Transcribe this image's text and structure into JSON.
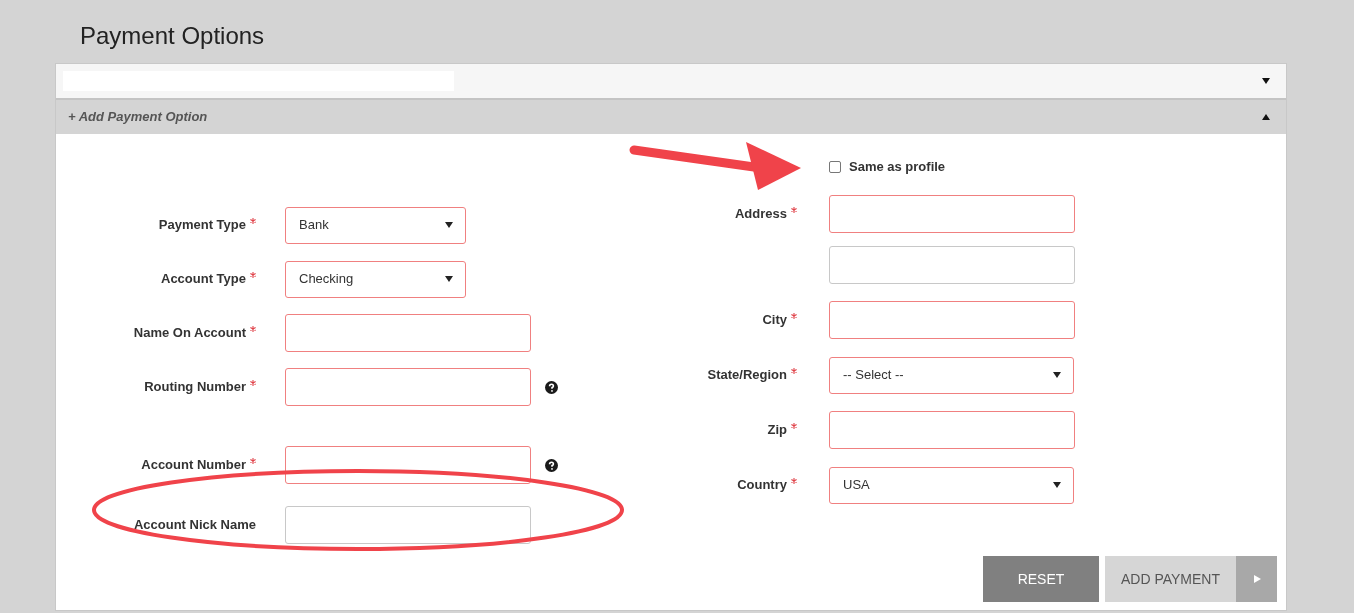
{
  "page_title": "Payment Options",
  "collapsed_section": {
    "expanded": false
  },
  "add_section": {
    "title": "+ Add Payment Option",
    "expanded": true
  },
  "same_as_profile": {
    "label": "Same as profile",
    "checked": false
  },
  "left_fields": [
    {
      "label": "Payment Type",
      "required": true,
      "kind": "select",
      "value": "Bank",
      "help": false
    },
    {
      "label": "Account Type",
      "required": true,
      "kind": "select",
      "value": "Checking",
      "help": false
    },
    {
      "label": "Name On Account",
      "required": true,
      "kind": "input",
      "help": false
    },
    {
      "label": "Routing Number",
      "required": true,
      "kind": "input",
      "help": true
    },
    {
      "label": "Account Number",
      "required": true,
      "kind": "input",
      "help": true
    },
    {
      "label": "Account Nick Name",
      "required": false,
      "kind": "input",
      "help": false
    }
  ],
  "right_fields": [
    {
      "label": "Address",
      "required": true,
      "kind": "input"
    },
    {
      "required": false,
      "kind": "input"
    },
    {
      "label": "City",
      "required": true,
      "kind": "input"
    },
    {
      "label": "State/Region",
      "required": true,
      "kind": "select",
      "value": "-- Select --"
    },
    {
      "label": "Zip",
      "required": true,
      "kind": "input"
    },
    {
      "label": "Country",
      "required": true,
      "kind": "select",
      "value": "USA"
    }
  ],
  "buttons": [
    {
      "label": "RESET",
      "kind": "secondary"
    },
    {
      "label": "ADD PAYMENT",
      "kind": "primary"
    }
  ]
}
